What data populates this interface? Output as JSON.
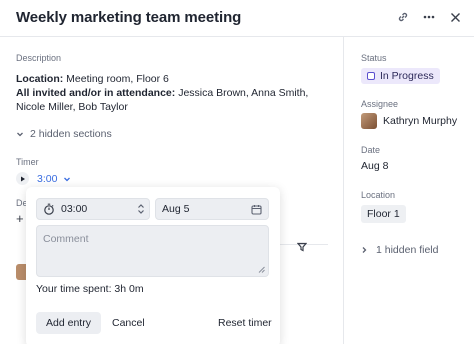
{
  "header": {
    "title": "Weekly marketing team meeting",
    "actions": [
      "link-icon",
      "more-icon",
      "close-icon"
    ]
  },
  "description": {
    "label": "Description",
    "location_key": "Location:",
    "location_value": " Meeting room, Floor 6",
    "attendance_key": "All invited and/or in attendance:",
    "attendance_value": " Jessica Brown, Anna Smith, Nicole Miller, Bob Taylor",
    "hidden_sections": "2 hidden sections"
  },
  "timer": {
    "label": "Timer",
    "value": "3:00"
  },
  "partial_label": "De",
  "time_entry": {
    "time_value": "03:00",
    "date_value": "Aug 5",
    "comment_placeholder": "Comment",
    "time_spent": "Your time spent: 3h 0m",
    "add_label": "Add entry",
    "cancel_label": "Cancel",
    "reset_label": "Reset timer"
  },
  "sidebar": {
    "status_label": "Status",
    "status_value": "In Progress",
    "assignee_label": "Assignee",
    "assignee_value": "Kathryn Murphy",
    "date_label": "Date",
    "date_value": "Aug 8",
    "location_label": "Location",
    "location_value": "Floor 1",
    "hidden_field": "1 hidden field"
  },
  "colors": {
    "accent": "#3a6de0",
    "status_bg": "#ece8fb",
    "status_border": "#5a4fcf"
  }
}
